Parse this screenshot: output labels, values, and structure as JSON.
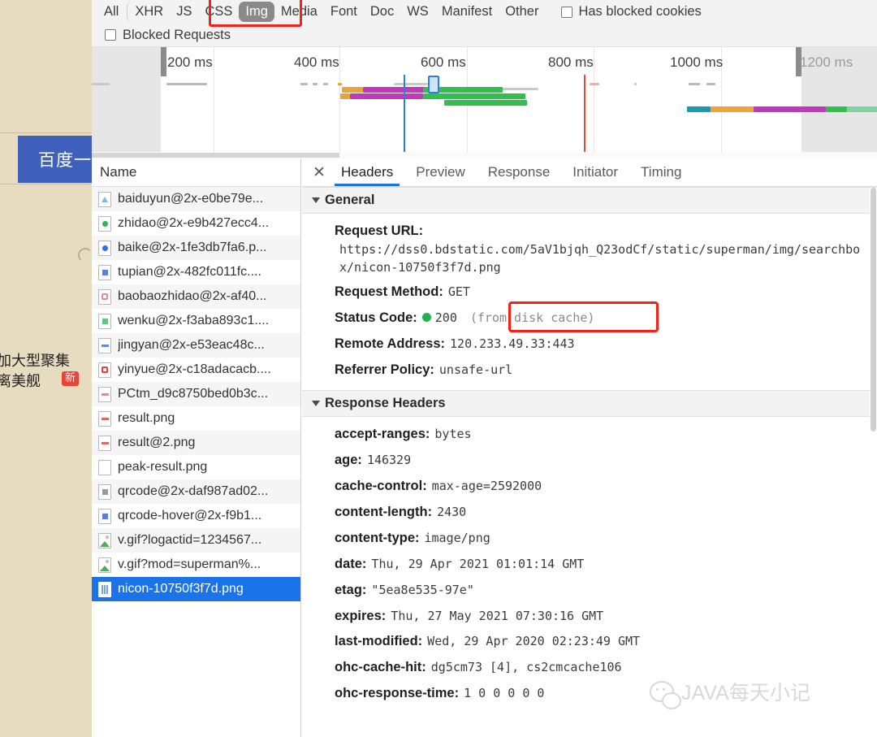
{
  "page_sliver": {
    "card_text": "百度一",
    "line1": "加大型聚集",
    "line2": "离美舰",
    "badge": "新"
  },
  "filter_bar": {
    "types": [
      "All",
      "XHR",
      "JS",
      "CSS",
      "Img",
      "Media",
      "Font",
      "Doc",
      "WS",
      "Manifest",
      "Other"
    ],
    "active_type": "Img",
    "has_blocked_cookies_label": "Has blocked cookies",
    "blocked_requests_label": "Blocked Requests"
  },
  "overview": {
    "ticks": [
      "200 ms",
      "400 ms",
      "600 ms",
      "800 ms",
      "1000 ms",
      "1200 ms"
    ]
  },
  "requests": {
    "column_header": "Name",
    "items": [
      {
        "name": "baiduyun@2x-e0be79e...",
        "icon": "image-thumb-icon",
        "color": "#7fb8e0",
        "shape": "tri"
      },
      {
        "name": "zhidao@2x-e9b427ecc4...",
        "icon": "image-thumb-icon",
        "color": "#2fb457",
        "shape": "dot"
      },
      {
        "name": "baike@2x-1fe3db7fa6.p...",
        "icon": "image-thumb-icon",
        "color": "#2f6fe0",
        "shape": "dot"
      },
      {
        "name": "tupian@2x-482fc011fc....",
        "icon": "image-thumb-icon",
        "color": "#5b7fd4",
        "shape": "sq"
      },
      {
        "name": "baobaozhidao@2x-af40...",
        "icon": "image-thumb-icon",
        "color": "#e98b8b",
        "shape": "ring"
      },
      {
        "name": "wenku@2x-f3aba893c1....",
        "icon": "image-thumb-icon",
        "color": "#67c08a",
        "shape": "sq"
      },
      {
        "name": "jingyan@2x-e53eac48c...",
        "icon": "image-thumb-icon",
        "color": "#5b8fd4",
        "shape": "bar"
      },
      {
        "name": "yinyue@2x-c18adacacb....",
        "icon": "image-thumb-icon",
        "color": "#e8403f",
        "shape": "ring"
      },
      {
        "name": "PCtm_d9c8750bed0b3c...",
        "icon": "image-thumb-icon",
        "color": "#d48fa0",
        "shape": "bar"
      },
      {
        "name": "result.png",
        "icon": "image-thumb-icon",
        "color": "#e06666",
        "shape": "bar"
      },
      {
        "name": "result@2.png",
        "icon": "image-thumb-icon",
        "color": "#e06666",
        "shape": "bar"
      },
      {
        "name": "peak-result.png",
        "icon": "image-thumb-icon",
        "color": "#ffffff",
        "shape": "none"
      },
      {
        "name": "qrcode@2x-daf987ad02...",
        "icon": "image-thumb-icon",
        "color": "#9a9a9a",
        "shape": "sq"
      },
      {
        "name": "qrcode-hover@2x-f9b1...",
        "icon": "image-thumb-icon",
        "color": "#5b7fd4",
        "shape": "sq"
      },
      {
        "name": "v.gif?logactid=1234567...",
        "icon": "gif-thumb-icon",
        "color": "#5aa85a",
        "shape": "gif"
      },
      {
        "name": "v.gif?mod=superman%...",
        "icon": "gif-thumb-icon",
        "color": "#5aa85a",
        "shape": "gif"
      },
      {
        "name": "nicon-10750f3f7d.png",
        "icon": "image-thumb-icon",
        "color": "#6fa8dc",
        "shape": "sel",
        "selected": true
      }
    ]
  },
  "details": {
    "close_label": "✕",
    "tabs": [
      "Headers",
      "Preview",
      "Response",
      "Initiator",
      "Timing"
    ],
    "active_tab": "Headers",
    "general": {
      "title": "General",
      "request_url_key": "Request URL:",
      "request_url_value": "https://dss0.bdstatic.com/5aV1bjqh_Q23odCf/static/superman/img/searchbox/nicon-10750f3f7d.png",
      "request_method_key": "Request Method:",
      "request_method_value": "GET",
      "status_code_key": "Status Code:",
      "status_code_value": "200",
      "status_code_note": "(from disk cache)",
      "remote_address_key": "Remote Address:",
      "remote_address_value": "120.233.49.33:443",
      "referrer_policy_key": "Referrer Policy:",
      "referrer_policy_value": "unsafe-url"
    },
    "response_headers": {
      "title": "Response Headers",
      "rows": [
        {
          "key": "accept-ranges:",
          "value": "bytes"
        },
        {
          "key": "age:",
          "value": "146329"
        },
        {
          "key": "cache-control:",
          "value": "max-age=2592000"
        },
        {
          "key": "content-length:",
          "value": "2430"
        },
        {
          "key": "content-type:",
          "value": "image/png"
        },
        {
          "key": "date:",
          "value": "Thu, 29 Apr 2021 01:01:14 GMT"
        },
        {
          "key": "etag:",
          "value": "\"5ea8e535-97e\""
        },
        {
          "key": "expires:",
          "value": "Thu, 27 May 2021 07:30:16 GMT"
        },
        {
          "key": "last-modified:",
          "value": "Wed, 29 Apr 2020 02:23:49 GMT"
        },
        {
          "key": "ohc-cache-hit:",
          "value": "dg5cm73 [4], cs2cmcache106"
        },
        {
          "key": "ohc-response-time:",
          "value": "1 0 0 0 0 0"
        }
      ]
    }
  },
  "watermark": {
    "text": "JAVA每天小记"
  },
  "colors": {
    "accent_blue": "#1a73e8",
    "annotation_red": "#f2231b",
    "status_green": "#22b14c",
    "selected_row": "#1a73e8",
    "page_background": "#e8dcc0"
  }
}
